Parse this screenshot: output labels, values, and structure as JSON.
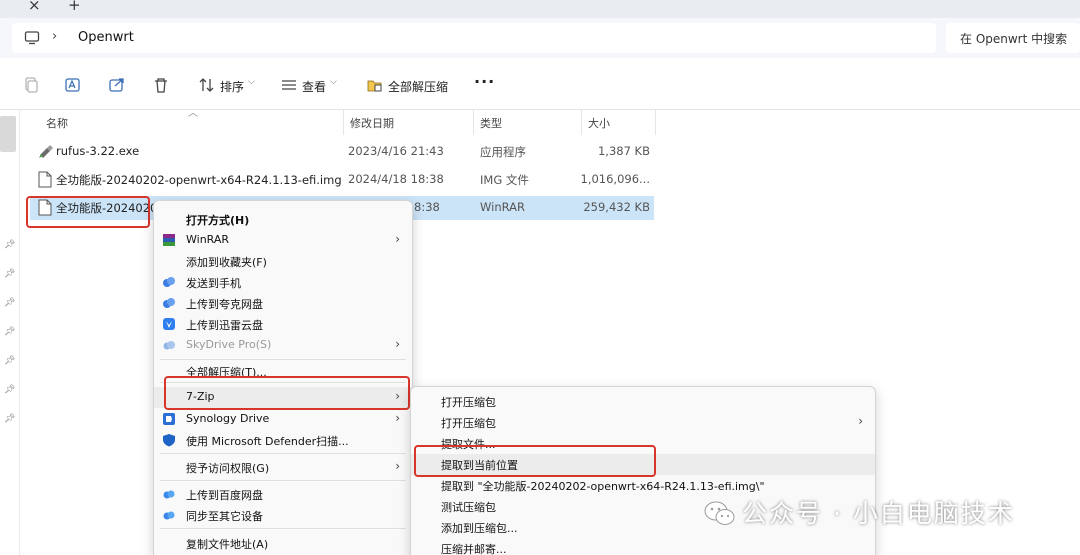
{
  "tabbar": {
    "close_glyph": "×",
    "new_glyph": "+"
  },
  "address": {
    "chevron": "›",
    "path": "Openwrt",
    "search_placeholder": "在 Openwrt 中搜索"
  },
  "toolbar": {
    "sort_label": "排序",
    "view_label": "查看",
    "extract_all_label": "全部解压缩",
    "more_label": "···"
  },
  "columns": {
    "name": "名称",
    "modified": "修改日期",
    "type": "类型",
    "size": "大小"
  },
  "files": [
    {
      "name": "rufus-3.22.exe",
      "modified": "2023/4/16 21:43",
      "type": "应用程序",
      "size": "1,387 KB"
    },
    {
      "name": "全功能版-20240202-openwrt-x64-R24.1.13-efi.img",
      "modified": "2024/4/18 18:38",
      "type": "IMG 文件",
      "size": "1,016,096..."
    },
    {
      "name": "全功能版-20240202",
      "modified": "8:38",
      "type": "WinRAR",
      "size": "259,432 KB"
    }
  ],
  "context_menu": {
    "items": [
      {
        "label": "打开方式(H)"
      },
      {
        "label": "WinRAR"
      },
      {
        "label": "添加到收藏夹(F)"
      },
      {
        "label": "发送到手机"
      },
      {
        "label": "上传到夸克网盘"
      },
      {
        "label": "上传到迅雷云盘"
      },
      {
        "label": "SkyDrive Pro(S)"
      },
      {
        "label": "全部解压缩(T)..."
      },
      {
        "label": "7-Zip"
      },
      {
        "label": "Synology Drive"
      },
      {
        "label": "使用 Microsoft Defender扫描..."
      },
      {
        "label": "授予访问权限(G)"
      },
      {
        "label": "上传到百度网盘"
      },
      {
        "label": "同步至其它设备"
      },
      {
        "label": "复制文件地址(A)"
      }
    ]
  },
  "submenu": {
    "items": [
      {
        "label": "打开压缩包"
      },
      {
        "label": "打开压缩包"
      },
      {
        "label": "提取文件..."
      },
      {
        "label": "提取到当前位置"
      },
      {
        "label": "提取到 \"全功能版-20240202-openwrt-x64-R24.1.13-efi.img\\\""
      },
      {
        "label": "测试压缩包"
      },
      {
        "label": "添加到压缩包..."
      },
      {
        "label": "压缩并邮寄..."
      }
    ]
  },
  "watermark": {
    "text": "公众号 · 小白电脑技术"
  },
  "colors": {
    "accent_red": "#d9362b",
    "selection": "#cce4f7"
  }
}
